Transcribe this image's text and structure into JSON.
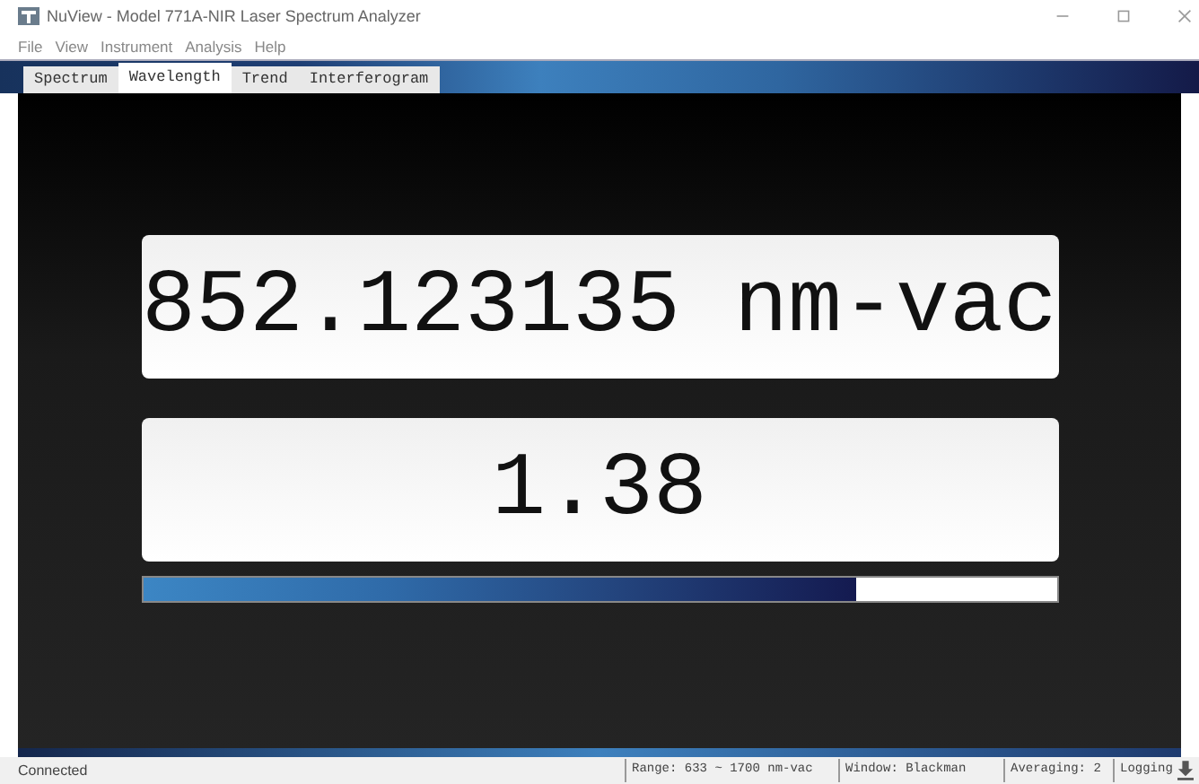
{
  "window": {
    "title": "NuView - Model 771A-NIR Laser Spectrum Analyzer"
  },
  "menu": [
    "File",
    "View",
    "Instrument",
    "Analysis",
    "Help"
  ],
  "tabs": [
    {
      "label": "Spectrum",
      "selected": false
    },
    {
      "label": "Wavelength",
      "selected": true
    },
    {
      "label": "Trend",
      "selected": false
    },
    {
      "label": "Interferogram",
      "selected": false
    }
  ],
  "wavelength": {
    "value": "852.123135 nm-vac"
  },
  "power": {
    "value": "1.38",
    "level": 0.78
  },
  "status_bar": {
    "connection": "Connected",
    "range": "Range: 633 ~ 1700 nm-vac",
    "window": "Window: Blackman",
    "averaging": "Averaging: 2",
    "logging": "Logging"
  }
}
